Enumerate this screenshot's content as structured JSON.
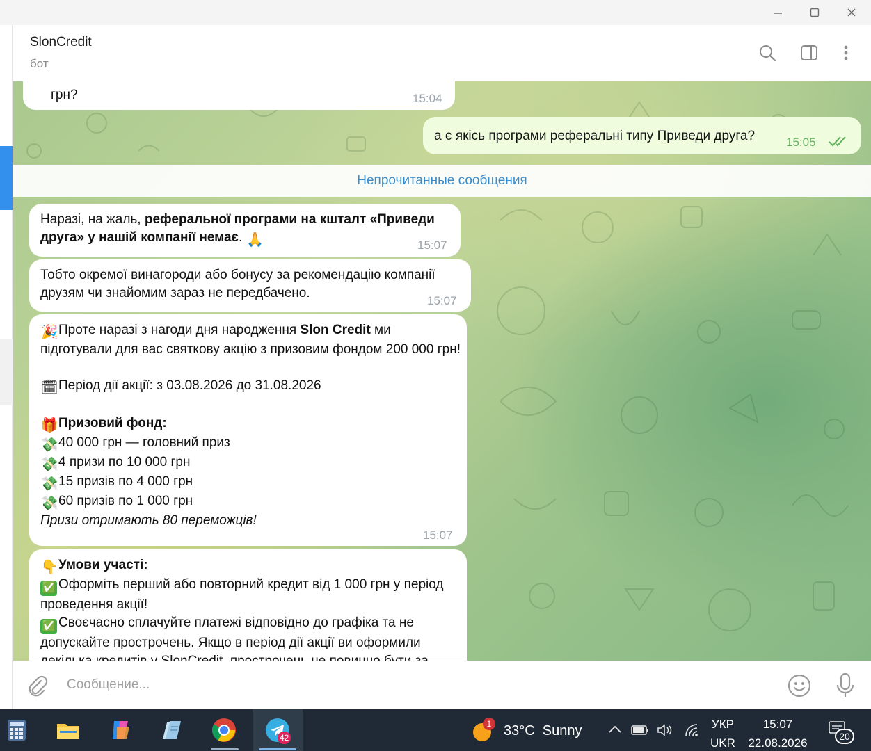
{
  "window": {
    "minimize": "minimize",
    "maximize": "maximize",
    "close": "close"
  },
  "header": {
    "name": "SlonCredit",
    "status": "бот"
  },
  "unread_label": "Непрочитанные сообщения",
  "messages": {
    "m0": {
      "text": "грн?",
      "time": "15:04"
    },
    "m1": {
      "text": "а є якісь програми реферальні типу Приведи друга?",
      "time": "15:05"
    },
    "m2": {
      "a": "Наразі, на жаль, ",
      "b": "реферальної програми на кшталт «Приведи друга» у нашій компанії немає",
      "c": ".",
      "emoji": "🙏",
      "time": "15:07"
    },
    "m3": {
      "text": "Тобто окремої винагороди або бонусу за рекомендацію компанії друзям чи знайомим зараз не передбачено.",
      "time": "15:07"
    },
    "m4": {
      "l1a": "Проте наразі з нагоди дня народження ",
      "l1b": "Slon Credit",
      "l1c": " ми підготували для вас святкову акцію з призовим фондом 200 000 грн!",
      "period": "Період дії акції: з 03.08.2026 до 31.08.2026",
      "fund": "Призовий фонд:",
      "prizes": [
        "40 000 грн — головний приз",
        "4 призи по 10 000 грн",
        "15 призів по 4 000 грн",
        "60 призів по 1 000 грн"
      ],
      "footer": "Призи отримають 80 переможців!",
      "time": "15:07",
      "emoji_party": "🎉",
      "emoji_cal": "🗓",
      "emoji_gift": "🎁",
      "emoji_money": "💸"
    },
    "m5": {
      "title": "Умови участі:",
      "c1": "Оформіть перший або повторний кредит від 1 000 грн у період проведення акції!",
      "c2": "Своєчасно сплачуйте платежі відповідно до графіка та не допускайте прострочень. Якщо в період дії акції ви оформили декілька кредитів у SlonCredit, прострочень не повинно бути за",
      "emoji_point": "👇",
      "emoji_check": "✅"
    }
  },
  "composer": {
    "placeholder": "Сообщение..."
  },
  "taskbar": {
    "telegram_badge": "42",
    "weather_badge": "1",
    "weather": "33°C  Sunny",
    "lang_top": "УКР",
    "lang_bottom": "UKR",
    "time": "15:07",
    "date": "22.08.2026",
    "notif_count": "20"
  },
  "colors": {
    "accent": "#3390ec",
    "outgoing": "#effdde",
    "taskbar": "#1f2a36"
  }
}
